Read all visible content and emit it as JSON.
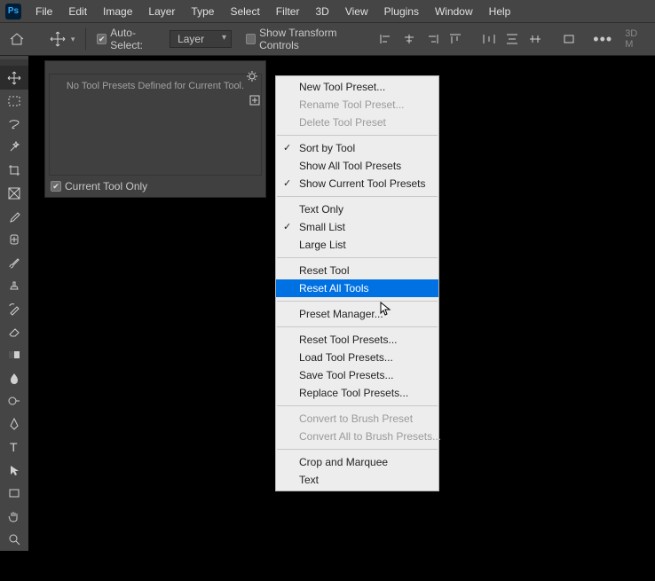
{
  "menubar": {
    "items": [
      "File",
      "Edit",
      "Image",
      "Layer",
      "Type",
      "Select",
      "Filter",
      "3D",
      "View",
      "Plugins",
      "Window",
      "Help"
    ]
  },
  "optbar": {
    "auto_select": "Auto-Select:",
    "layer_select": "Layer",
    "show_transform": "Show Transform Controls",
    "three_d": "3D M"
  },
  "panel": {
    "body_text": "No Tool Presets Defined for Current Tool.",
    "footer_label": "Current Tool Only"
  },
  "ctx": {
    "items": [
      {
        "label": "New Tool Preset..."
      },
      {
        "label": "Rename Tool Preset...",
        "disabled": true
      },
      {
        "label": "Delete Tool Preset",
        "disabled": true
      },
      {
        "sep": true
      },
      {
        "label": "Sort by Tool",
        "checked": true
      },
      {
        "label": "Show All Tool Presets"
      },
      {
        "label": "Show Current Tool Presets",
        "checked": true
      },
      {
        "sep": true
      },
      {
        "label": "Text Only"
      },
      {
        "label": "Small List",
        "checked": true
      },
      {
        "label": "Large List"
      },
      {
        "sep": true
      },
      {
        "label": "Reset Tool"
      },
      {
        "label": "Reset All Tools",
        "selected": true
      },
      {
        "sep": true
      },
      {
        "label": "Preset Manager..."
      },
      {
        "sep": true
      },
      {
        "label": "Reset Tool Presets..."
      },
      {
        "label": "Load Tool Presets..."
      },
      {
        "label": "Save Tool Presets..."
      },
      {
        "label": "Replace Tool Presets..."
      },
      {
        "sep": true
      },
      {
        "label": "Convert to Brush Preset",
        "disabled": true
      },
      {
        "label": "Convert All to Brush Presets...",
        "disabled": true
      },
      {
        "sep": true
      },
      {
        "label": "Crop and Marquee"
      },
      {
        "label": "Text"
      }
    ]
  }
}
